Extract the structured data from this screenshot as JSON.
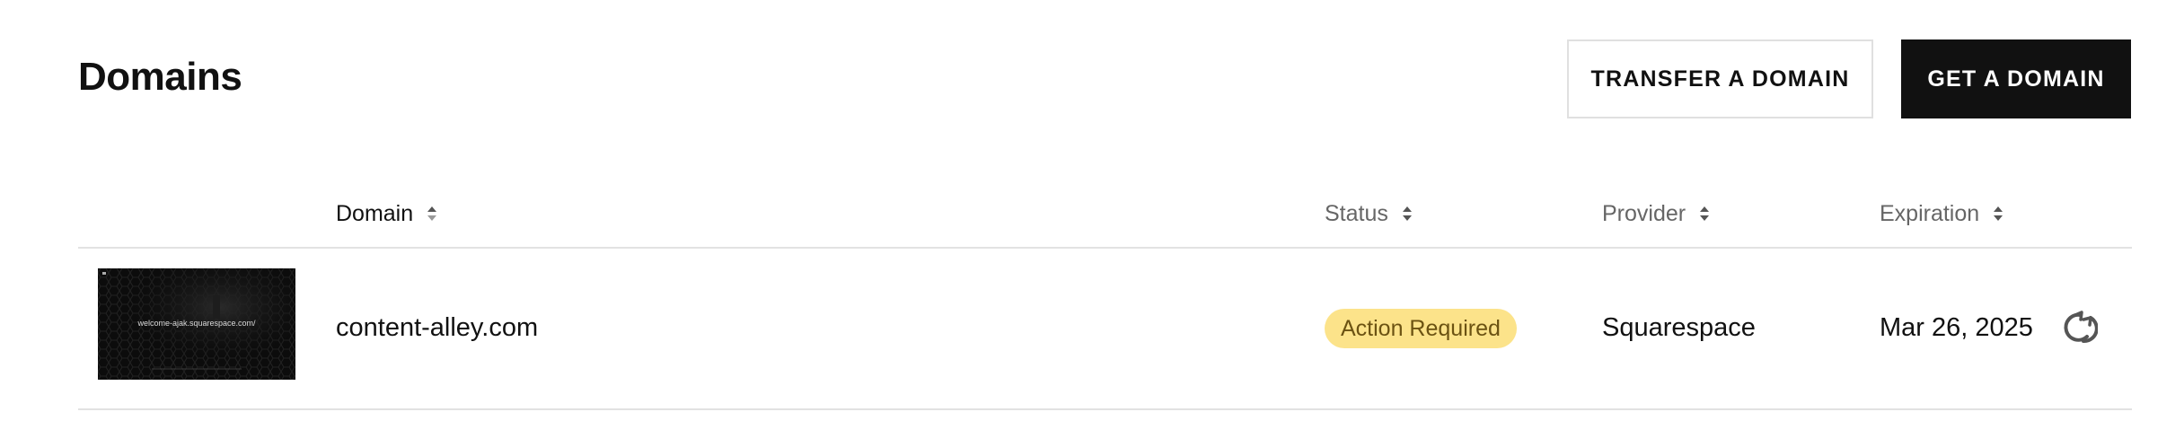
{
  "header": {
    "title": "Domains",
    "transfer_button_label": "TRANSFER A DOMAIN",
    "get_button_label": "GET A DOMAIN"
  },
  "table": {
    "columns": [
      {
        "label": "Domain",
        "icon": "sort-icon"
      },
      {
        "label": "Status",
        "icon": "sort-icon"
      },
      {
        "label": "Provider",
        "icon": "sort-icon"
      },
      {
        "label": "Expiration",
        "icon": "sort-icon"
      }
    ],
    "rows": [
      {
        "thumbnail_text": "welcome-ajak.squarespace.com/",
        "domain": "content-alley.com",
        "status": "Action Required",
        "provider": "Squarespace",
        "expiration": "Mar 26, 2025",
        "action_icon": "auto-renew-icon"
      }
    ]
  },
  "colors": {
    "primary_button_bg": "#111111",
    "badge_bg": "#fce38a",
    "badge_text": "#6b5212",
    "divider": "#e2e2e2"
  }
}
